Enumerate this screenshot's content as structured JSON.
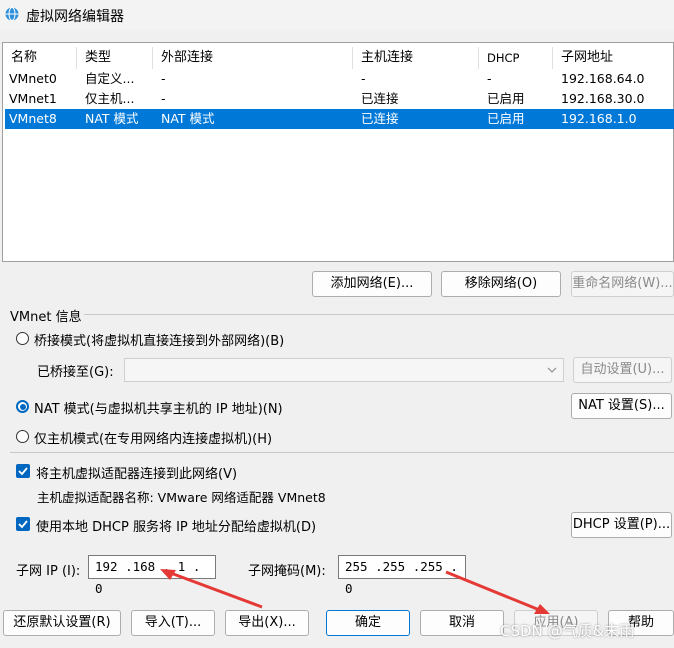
{
  "window": {
    "title": "虚拟网络编辑器"
  },
  "list": {
    "headers": [
      "名称",
      "类型",
      "外部连接",
      "主机连接",
      "DHCP",
      "子网地址"
    ],
    "rows": [
      [
        "VMnet0",
        "自定义...",
        "-",
        "-",
        "-",
        "192.168.64.0"
      ],
      [
        "VMnet1",
        "仅主机...",
        "-",
        "已连接",
        "已启用",
        "192.168.30.0"
      ],
      [
        "VMnet8",
        "NAT 模式",
        "NAT 模式",
        "已连接",
        "已启用",
        "192.168.1.0"
      ]
    ],
    "selected_row": 2
  },
  "list_buttons": {
    "add": "添加网络(E)...",
    "remove": "移除网络(O)",
    "rename": "重命名网络(W)..."
  },
  "vmnet_info": {
    "group_label": "VMnet 信息",
    "bridged": "桥接模式(将虚拟机直接连接到外部网络)(B)",
    "bridged_to": "已桥接至(G):",
    "auto_settings": "自动设置(U)...",
    "nat": "NAT 模式(与虚拟机共享主机的 IP 地址)(N)",
    "nat_settings": "NAT 设置(S)...",
    "host_only": "仅主机模式(在专用网络内连接虚拟机)(H)",
    "connect_adapter": "将主机虚拟适配器连接到此网络(V)",
    "adapter_name": "主机虚拟适配器名称: VMware 网络适配器 VMnet8",
    "use_dhcp": "使用本地 DHCP 服务将 IP 地址分配给虚拟机(D)",
    "dhcp_settings": "DHCP 设置(P)...",
    "subnet_ip_label": "子网 IP (I):",
    "subnet_ip": "192 .168 . 1 . 0",
    "subnet_mask_label": "子网掩码(M):",
    "subnet_mask": "255 .255 .255 . 0",
    "selected_mode": "nat",
    "connect_adapter_checked": true,
    "use_dhcp_checked": true
  },
  "footer": {
    "restore": "还原默认设置(R)",
    "import": "导入(T)...",
    "export": "导出(X)...",
    "ok": "确定",
    "cancel": "取消",
    "apply": "应用(A)",
    "help": "帮助"
  },
  "watermark": "CSDN @气质&末雨",
  "colors": {
    "selection": "#0078d7",
    "accent": "#0067c0",
    "annotation_arrow": "#e53935"
  }
}
